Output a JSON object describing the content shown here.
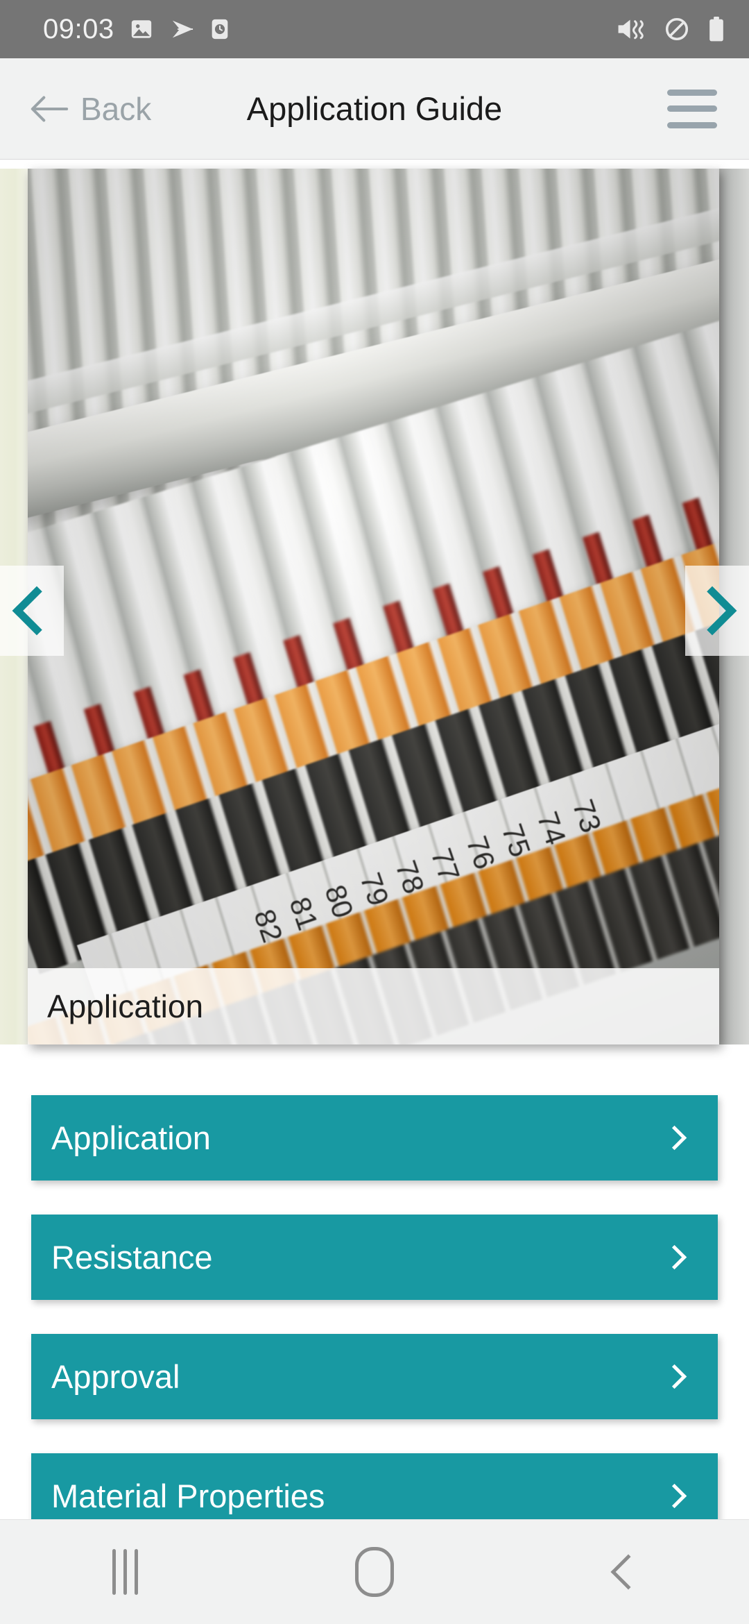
{
  "status_bar": {
    "time": "09:03",
    "left_icons": [
      "image-icon",
      "send-icon",
      "clock-icon"
    ],
    "right_icons": [
      "vibrate-mute-icon",
      "do-not-disturb-icon",
      "battery-icon"
    ],
    "background_color": "#757575"
  },
  "header": {
    "back_label": "Back",
    "title": "Application Guide",
    "menu_icon": "hamburger-menu-icon",
    "background_color": "#f1f2f2"
  },
  "carousel": {
    "caption": "Application",
    "prev_icon": "chevron-left-icon",
    "next_icon": "chevron-right-icon",
    "image_alt": "terminal-block-with-white-cables-and-orange-levers",
    "label_numbers": [
      "82",
      "81",
      "80",
      "79",
      "78",
      "77",
      "76",
      "75",
      "74",
      "73"
    ]
  },
  "menu": {
    "accent_color": "#1899a2",
    "items": [
      {
        "label": "Application",
        "chevron": "chevron-right-icon"
      },
      {
        "label": "Resistance",
        "chevron": "chevron-right-icon"
      },
      {
        "label": "Approval",
        "chevron": "chevron-right-icon"
      },
      {
        "label": "Material Properties",
        "chevron": "chevron-right-icon"
      }
    ]
  },
  "nav_bar": {
    "recents_icon": "recents-icon",
    "home_icon": "home-icon",
    "back_icon": "back-icon"
  }
}
